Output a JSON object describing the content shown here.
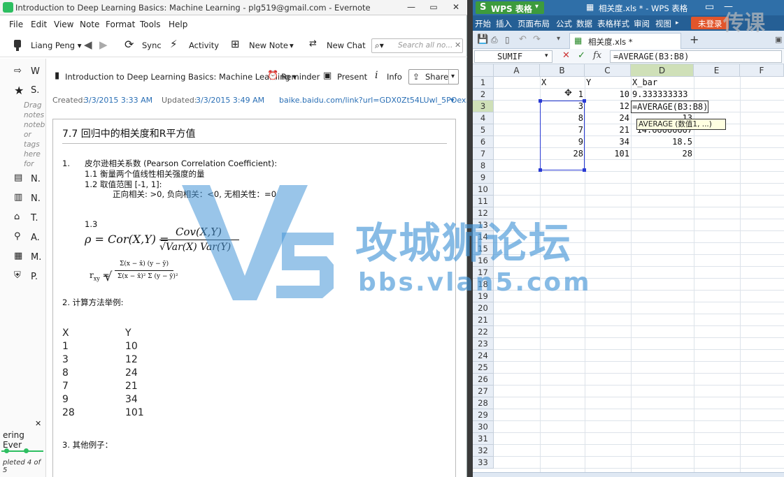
{
  "evernote": {
    "window_title": "Introduction to Deep Learning Basics: Machine Learning - plg519@gmail.com - Evernote",
    "menu": [
      "File",
      "Edit",
      "View",
      "Note",
      "Format",
      "Tools",
      "Help"
    ],
    "toolbar": {
      "user": "Liang Peng",
      "sync": "Sync",
      "activity": "Activity",
      "new_note": "New Note",
      "new_chat": "New Chat",
      "search_placeholder": "Search all no..."
    },
    "sidebar": {
      "items_top": [
        "W",
        "S."
      ],
      "hint_lines": [
        "Drag",
        "notes",
        "noteb",
        "or",
        "tags",
        "here",
        "for"
      ],
      "items_bottom": [
        "N.",
        "N.",
        "T.",
        "A.",
        "M.",
        "P."
      ],
      "footer_title": "ering Ever",
      "footer_progress": "pleted 4 of 5"
    },
    "note": {
      "notebook_title": "Introduction to Deep Learning Basics: Machine Learning",
      "reminder": "Reminder",
      "present": "Present",
      "info": "Info",
      "share": "Share",
      "created_label": "Created:",
      "created_value": "3/3/2015 3:33 AM",
      "updated_label": "Updated:",
      "updated_value": "3/3/2015 3:49 AM",
      "source_link": "baike.baidu.com/link?url=GDX0Zt54LUwl_5POex...",
      "heading": "7.7 回归中的相关度和R平方值",
      "item1_num": "1.",
      "item1_title": "皮尔逊相关系数 (Pearson Correlation Coefficient):",
      "item1_1": "1.1 衡量两个值线性相关强度的量",
      "item1_2": "1.2 取值范围 [-1, 1]:",
      "item1_2_detail": "正向相关: >0, 负向相关：<0, 无相关性：=0",
      "item1_3": "1.3",
      "formula1_lhs": "ρ = Cor(X,Y) =",
      "formula1_num": "Cov(X,Y)",
      "formula1_den": "√Var(X) Var(Y)",
      "formula2_lhs": "r",
      "formula2_sub": "xy",
      "formula2_num": "Σ(x − x̄) (y − ȳ)",
      "formula2_den": "Σ(x − x̄)² Σ (y − ȳ)²",
      "item2": "2. 计算方法举例:",
      "table_head": [
        "X",
        "Y"
      ],
      "table_rows": [
        [
          "1",
          "10"
        ],
        [
          "3",
          "12"
        ],
        [
          "8",
          "24"
        ],
        [
          "7",
          "21"
        ],
        [
          "9",
          "34"
        ],
        [
          "28",
          "101"
        ]
      ],
      "item3": "3. 其他例子："
    }
  },
  "wps": {
    "app_name": "WPS 表格",
    "window_title": "相关度.xls * - WPS 表格",
    "menu": [
      "开始",
      "插入",
      "页面布局",
      "公式",
      "数据",
      "表格样式",
      "审阅",
      "视图"
    ],
    "login": "未登录",
    "doc_tab": "相关度.xls *",
    "name_box": "SUMIF",
    "formula": "=AVERAGE(B3:B8)",
    "columns": [
      "A",
      "B",
      "C",
      "D",
      "E",
      "F"
    ],
    "rows": [
      "1",
      "2",
      "3",
      "4",
      "5",
      "6",
      "7",
      "8",
      "9",
      "10",
      "11",
      "12",
      "13",
      "14",
      "15",
      "16",
      "17",
      "18",
      "19",
      "20",
      "21",
      "22",
      "23",
      "24",
      "25",
      "26",
      "27",
      "28",
      "29",
      "30",
      "31",
      "32",
      "33"
    ],
    "cells": {
      "B1": "X",
      "C1": "Y",
      "D1": "X_bar",
      "B2": "1",
      "C2": "10",
      "D2": "9.333333333",
      "B3": "3",
      "C3": "12",
      "D3": "=AVERAGE(B3:B8)",
      "B4": "8",
      "C4": "24",
      "D4": "13",
      "B5": "7",
      "C5": "21",
      "D5": "14.66666667",
      "B6": "9",
      "C6": "34",
      "D6": "18.5",
      "B7": "28",
      "C7": "101",
      "D7": "28"
    },
    "tooltip": "AVERAGE (数值1, ...)"
  },
  "watermark": {
    "logo": "V5",
    "title": "攻城狮论坛",
    "url": "bbs.vlan5.com",
    "corner": "传课"
  }
}
